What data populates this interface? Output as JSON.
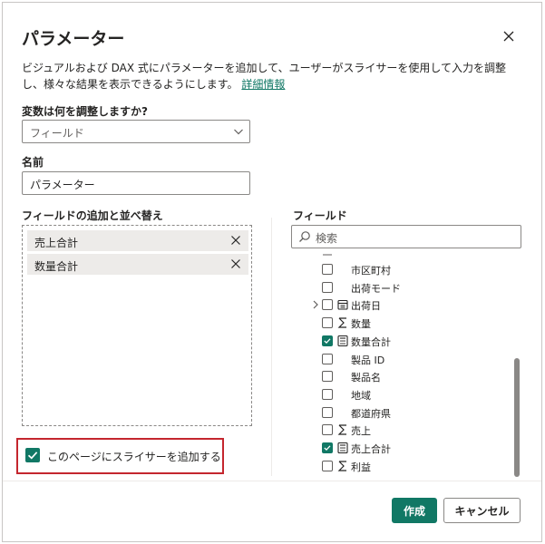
{
  "dialog": {
    "title": "パラメーター",
    "description": "ビジュアルおよび DAX 式にパラメーターを追加して、ユーザーがスライサーを使用して入力を調整し、様々な結果を表示できるようにします。",
    "learn_more": "詳細情報"
  },
  "variable": {
    "label": "変数は何を調整しますか?",
    "selected": "フィールド"
  },
  "name": {
    "label": "名前",
    "value": "パラメーター"
  },
  "add_fields": {
    "label": "フィールドの追加と並べ替え",
    "items": [
      {
        "label": "売上合計"
      },
      {
        "label": "数量合計"
      }
    ]
  },
  "fields_panel": {
    "label": "フィールド",
    "search_placeholder": "検索",
    "items": [
      {
        "label": "市区町村",
        "checked": false,
        "icon": "none"
      },
      {
        "label": "出荷モード",
        "checked": false,
        "icon": "none"
      },
      {
        "label": "出荷日",
        "checked": false,
        "icon": "calendar-icon",
        "expandable": true
      },
      {
        "label": "数量",
        "checked": false,
        "icon": "sigma-icon"
      },
      {
        "label": "数量合計",
        "checked": true,
        "icon": "calculator-icon"
      },
      {
        "label": "製品 ID",
        "checked": false,
        "icon": "none"
      },
      {
        "label": "製品名",
        "checked": false,
        "icon": "none"
      },
      {
        "label": "地域",
        "checked": false,
        "icon": "none"
      },
      {
        "label": "都道府県",
        "checked": false,
        "icon": "none"
      },
      {
        "label": "売上",
        "checked": false,
        "icon": "sigma-icon"
      },
      {
        "label": "売上合計",
        "checked": true,
        "icon": "calculator-icon"
      },
      {
        "label": "利益",
        "checked": false,
        "icon": "sigma-icon"
      }
    ]
  },
  "slicer_option": {
    "label": "このページにスライサーを追加する",
    "checked": true
  },
  "buttons": {
    "create": "作成",
    "cancel": "キャンセル"
  },
  "colors": {
    "accent": "#117865",
    "highlight_border": "#c4262e"
  }
}
